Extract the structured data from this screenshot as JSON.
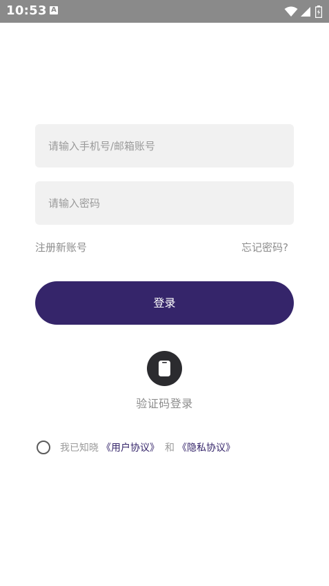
{
  "status_bar": {
    "time": "10:53",
    "notification_icon": "A",
    "icons": [
      "wifi-icon",
      "signal-icon",
      "battery-icon"
    ]
  },
  "form": {
    "account_placeholder": "请输入手机号/邮箱账号",
    "account_value": "",
    "password_placeholder": "请输入密码",
    "password_value": ""
  },
  "links": {
    "register": "注册新账号",
    "forgot_password": "忘记密码?"
  },
  "login_button": {
    "label": "登录"
  },
  "sms_login": {
    "icon": "phone-icon",
    "label": "验证码登录"
  },
  "agreement": {
    "prefix": "我已知晓",
    "user_agreement": "《用户协议》",
    "conjunction": "和",
    "privacy_policy": "《隐私协议》",
    "checked": false
  },
  "colors": {
    "primary": "#35256a",
    "input_bg": "#f1f1f1",
    "status_bar": "#8a8a8a",
    "muted_text": "#8c8c8c",
    "icon_circle": "#2b2b2f"
  }
}
